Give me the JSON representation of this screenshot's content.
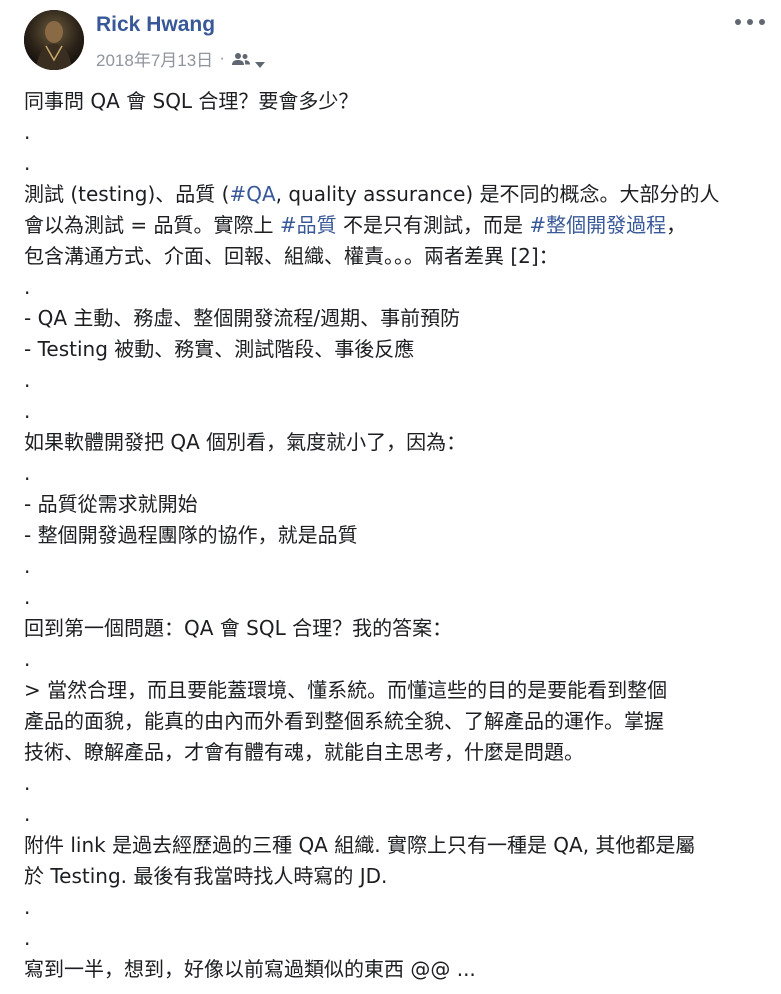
{
  "post": {
    "author": "Rick Hwang",
    "date": "2018年7月13日",
    "separator": "·",
    "audience_icon": "friends-icon",
    "audience_dropdown_icon": "chevron-down-icon",
    "more_icon": "more-options-icon",
    "colors": {
      "link": "#385898",
      "text": "#1c1e21",
      "meta": "#90949c"
    },
    "lines": [
      [
        {
          "t": "同事問 QA 會 SQL 合理？要會多少？"
        }
      ],
      [
        {
          "t": "."
        }
      ],
      [
        {
          "t": "."
        }
      ],
      [
        {
          "t": "測試 (testing)、品質 ("
        },
        {
          "t": "#QA",
          "tag": true
        },
        {
          "t": ", quality assurance) 是不同的概念。大部分的人"
        }
      ],
      [
        {
          "t": "會以為測試 = 品質。實際上 "
        },
        {
          "t": "#品質",
          "tag": true
        },
        {
          "t": " 不是只有測試，而是 "
        },
        {
          "t": "#整個開發過程",
          "tag": true
        },
        {
          "t": "，"
        }
      ],
      [
        {
          "t": "包含溝通方式、介面、回報、組織、權責。。。兩者差異 [2]："
        }
      ],
      [
        {
          "t": "."
        }
      ],
      [
        {
          "t": "- QA 主動、務虛、整個開發流程/週期、事前預防"
        }
      ],
      [
        {
          "t": "- Testing 被動、務實、測試階段、事後反應"
        }
      ],
      [
        {
          "t": "."
        }
      ],
      [
        {
          "t": "."
        }
      ],
      [
        {
          "t": "如果軟體開發把 QA 個別看，氣度就小了，因為："
        }
      ],
      [
        {
          "t": "."
        }
      ],
      [
        {
          "t": "- 品質從需求就開始"
        }
      ],
      [
        {
          "t": "- 整個開發過程團隊的協作，就是品質"
        }
      ],
      [
        {
          "t": "."
        }
      ],
      [
        {
          "t": "."
        }
      ],
      [
        {
          "t": "回到第一個問題：QA 會 SQL 合理？我的答案："
        }
      ],
      [
        {
          "t": "."
        }
      ],
      [
        {
          "t": "> 當然合理，而且要能蓋環境、懂系統。而懂這些的目的是要能看到整個"
        }
      ],
      [
        {
          "t": "產品的面貌，能真的由內而外看到整個系統全貌、了解產品的運作。掌握"
        }
      ],
      [
        {
          "t": "技術、瞭解產品，才會有體有魂，就能自主思考，什麼是問題。"
        }
      ],
      [
        {
          "t": "."
        }
      ],
      [
        {
          "t": "."
        }
      ],
      [
        {
          "t": "附件 link 是過去經歷過的三種 QA 組織. 實際上只有一種是 QA, 其他都是屬"
        }
      ],
      [
        {
          "t": "於 Testing. 最後有我當時找人時寫的 JD."
        }
      ],
      [
        {
          "t": "."
        }
      ],
      [
        {
          "t": "."
        }
      ],
      [
        {
          "t": "寫到一半，想到，好像以前寫過類似的東西 @@ ..."
        }
      ]
    ]
  }
}
